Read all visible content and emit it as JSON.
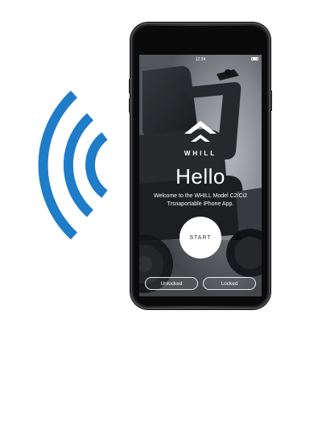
{
  "colors": {
    "signal_blue": "#1f7cc8",
    "phone_body": "#1b1b1d",
    "text_white": "#ffffff"
  },
  "status_bar": {
    "time": "12:34"
  },
  "splash": {
    "brand": "WHILL",
    "greeting": "Hello",
    "welcome_line1": "Welcome to the WHILL Model C2/Ci2",
    "welcome_line2": "Trsnaportable iPhone App.",
    "start_label": "START"
  },
  "lock_buttons": {
    "unlocked_label": "Unlocked",
    "locked_label": "Locked"
  },
  "icons": {
    "signal": "wireless-signal-icon",
    "logo": "whill-logo-icon",
    "battery": "battery-icon"
  }
}
